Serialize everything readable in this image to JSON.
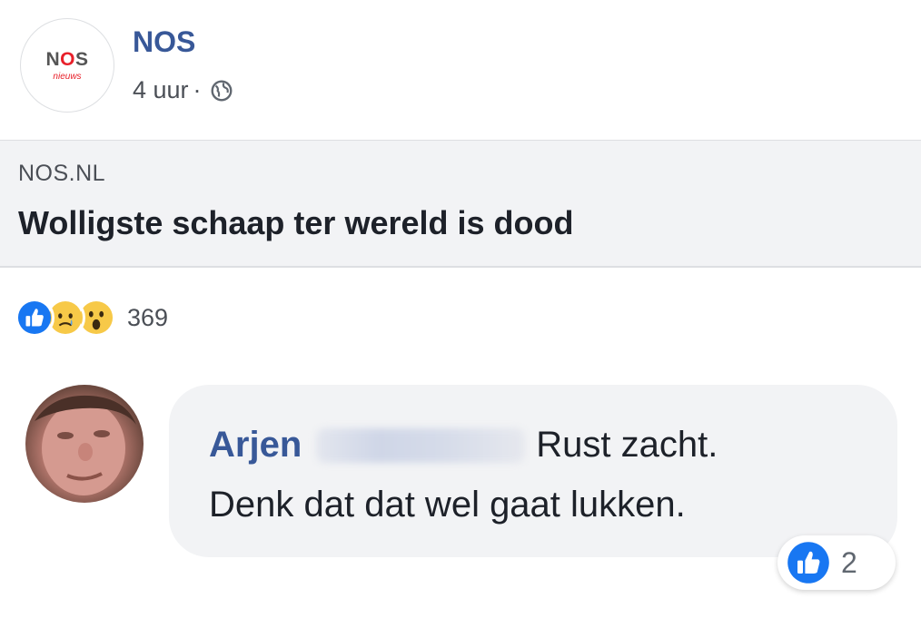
{
  "post": {
    "page_logo_text": "NOS",
    "page_logo_subtext": "nieuws",
    "page_name": "NOS",
    "time": "4 uur",
    "separator": "·",
    "audience_icon": "globe-icon"
  },
  "link_card": {
    "domain": "NOS.NL",
    "title": "Wolligste schaap ter wereld is dood"
  },
  "reactions": {
    "icons": [
      "like-icon",
      "sad-icon",
      "wow-icon"
    ],
    "count": "369"
  },
  "comment": {
    "author": "Arjen",
    "text_line1": "Rust zacht.",
    "text_line2": "Denk dat dat wel gaat lukken.",
    "reaction_icon": "like-icon",
    "reaction_count": "2"
  },
  "colors": {
    "link_blue": "#385898",
    "like_blue": "#1877f2",
    "nos_red": "#e8202a",
    "bubble_gray": "#f2f3f5"
  }
}
